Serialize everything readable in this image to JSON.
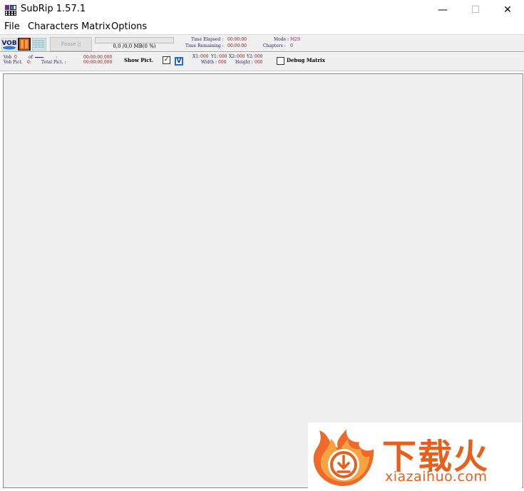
{
  "window": {
    "title": "SubRip 1.57.1",
    "minimize_glyph": "—",
    "maximize_glyph": "☐",
    "close_glyph": "✕"
  },
  "menu": [
    "File",
    "Characters Matrix",
    "Options"
  ],
  "toolbar": {
    "icons": [
      "vob-open-icon",
      "film-icon",
      "characters-matrix-icon"
    ],
    "vob_text": "VOB",
    "pause_label": "Pause ||",
    "progress_fraction": 0,
    "progress_text": "0,0 /0,0 MB(0 %)",
    "time_elapsed_label": "Time Elapsed :",
    "time_elapsed_value": "00:00:00",
    "time_remaining_label": "Time Remaining :",
    "time_remaining_value": "00:00:00",
    "mode_label": "Mode :",
    "mode_value": "M2S",
    "chapters_label": "Chapters :",
    "chapters_value": "0"
  },
  "info": {
    "vob_label": "Vob",
    "vob_value": "0",
    "vob_pict_label": "Vob Pict.",
    "vob_pict_value": "0:",
    "of_label": "of",
    "of_colon": ":",
    "total_pict_label": "Total Pict. :",
    "time1": "00:00:00,000",
    "time2": "00:00:00,000",
    "show_pict_label": "Show Pict.",
    "show_pict_checked": "✓",
    "v_label": "V",
    "x1_label": "X1:",
    "x1_value": "000",
    "y1_label": "Y1:",
    "y1_value": "000",
    "x2_label": "X2:",
    "x2_value": "000",
    "y2_label": "Y2:",
    "y2_value": "000",
    "width_label": "Width :",
    "width_value": "000",
    "height_label": "Height :",
    "height_value": "000",
    "debug_matrix_label": "Debug Matrix"
  },
  "watermark": {
    "chinese": "下载火",
    "latin": "xiazaihuo.com"
  },
  "colors": {
    "window_bg": "#f0f0f0",
    "accent_orange": "#e85f1c",
    "checkbox_blue": "#1a6fd8"
  }
}
